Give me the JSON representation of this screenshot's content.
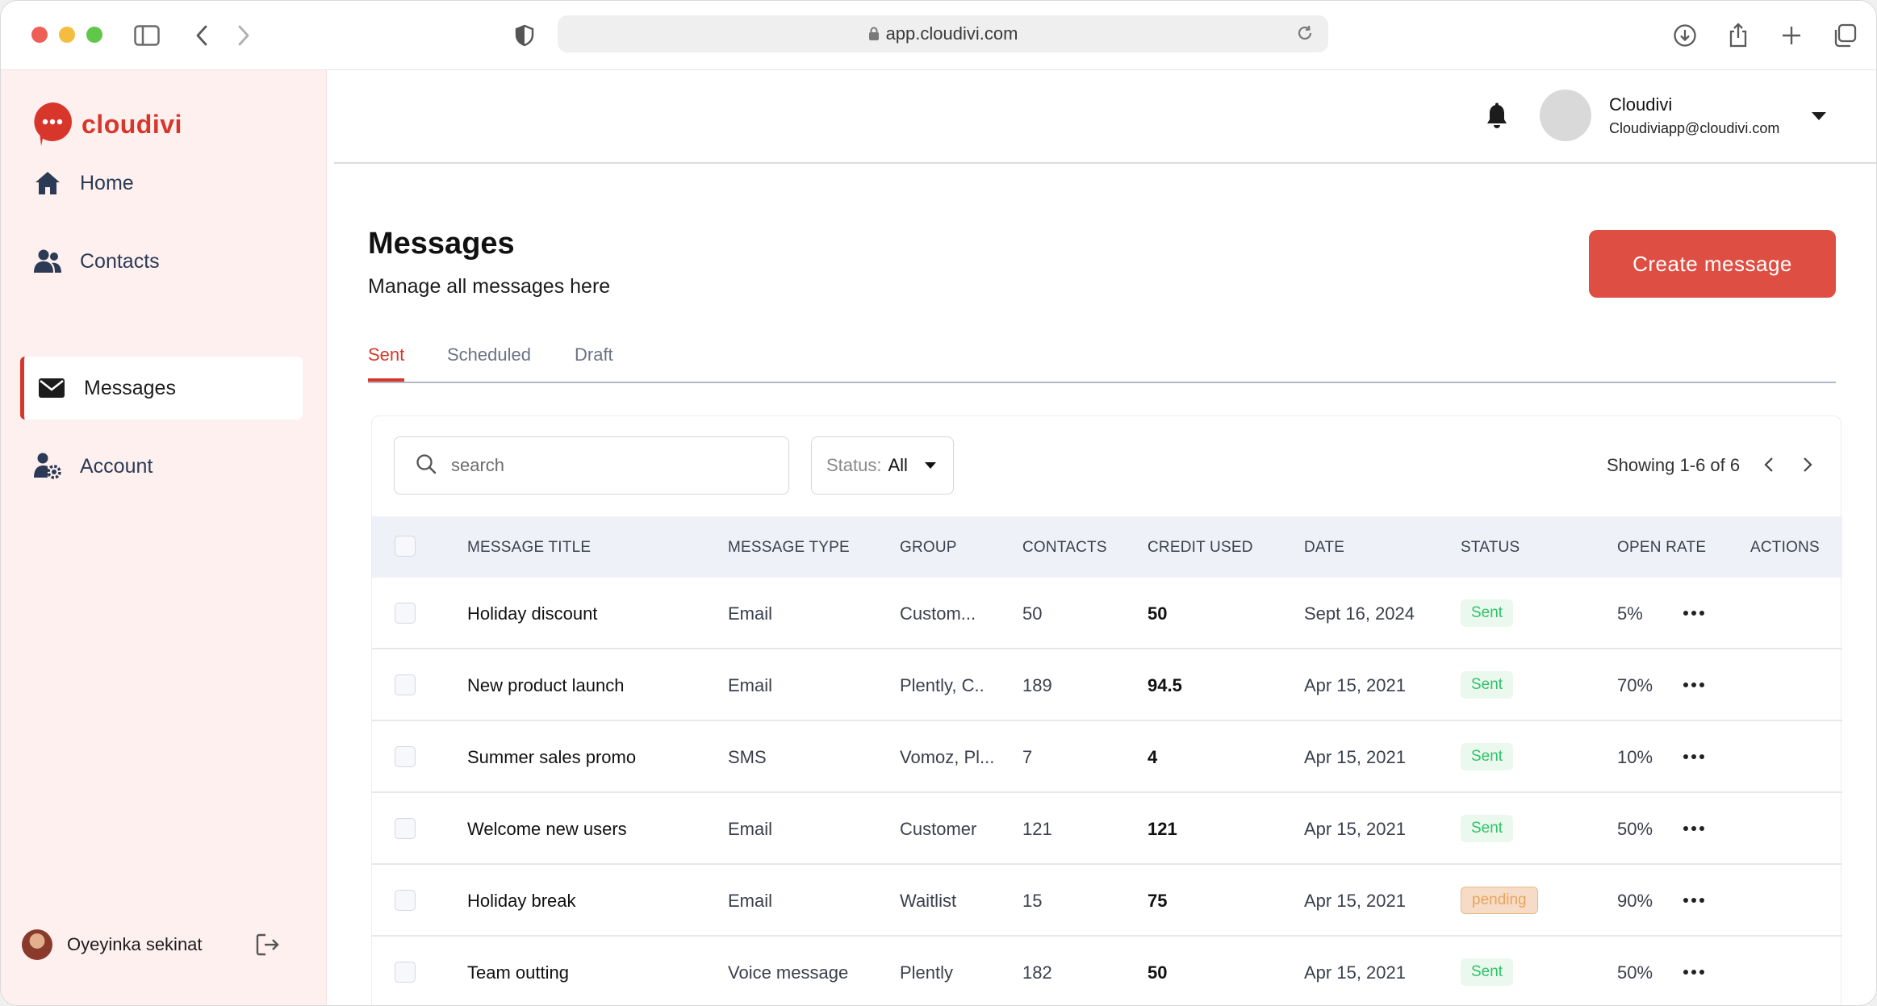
{
  "browser": {
    "url": "app.cloudivi.com"
  },
  "brand": {
    "name": "cloudivi",
    "accent": "#d8362b"
  },
  "sidebar": {
    "items": [
      {
        "label": "Home",
        "icon": "home-icon"
      },
      {
        "label": "Contacts",
        "icon": "contacts-icon"
      },
      {
        "label": "Messages",
        "icon": "envelope-icon",
        "active": true
      },
      {
        "label": "Account",
        "icon": "account-settings-icon"
      }
    ],
    "user": {
      "name": "Oyeyinka sekinat"
    }
  },
  "header": {
    "profile_name": "Cloudivi",
    "profile_email": "Cloudiviapp@cloudivi.com"
  },
  "page": {
    "title": "Messages",
    "subtitle": "Manage all messages here",
    "create_label": "Create  message"
  },
  "tabs": [
    {
      "label": "Sent",
      "active": true
    },
    {
      "label": "Scheduled"
    },
    {
      "label": "Draft"
    }
  ],
  "filters": {
    "search_placeholder": "search",
    "status_label": "Status:",
    "status_value": "All",
    "showing": "Showing 1-6 of 6"
  },
  "table": {
    "columns": [
      "MESSAGE TITLE",
      "MESSAGE TYPE",
      "GROUP",
      "CONTACTS",
      "CREDIT USED",
      "DATE",
      "STATUS",
      "OPEN RATE",
      "ACTIONS"
    ],
    "rows": [
      {
        "title": "Holiday discount",
        "type": "Email",
        "group": "Custom...",
        "contacts": "50",
        "credit": "50",
        "date": "Sept 16, 2024",
        "status": "Sent",
        "open_rate": "5%"
      },
      {
        "title": "New product launch",
        "type": "Email",
        "group": "Plently, C..",
        "contacts": "189",
        "credit": "94.5",
        "date": "Apr 15, 2021",
        "status": "Sent",
        "open_rate": "70%"
      },
      {
        "title": "Summer sales promo",
        "type": "SMS",
        "group": "Vomoz, Pl...",
        "contacts": "7",
        "credit": "4",
        "date": "Apr 15, 2021",
        "status": "Sent",
        "open_rate": "10%"
      },
      {
        "title": "Welcome new users",
        "type": "Email",
        "group": "Customer",
        "contacts": "121",
        "credit": "121",
        "date": "Apr 15, 2021",
        "status": "Sent",
        "open_rate": "50%"
      },
      {
        "title": "Holiday break",
        "type": "Email",
        "group": "Waitlist",
        "contacts": "15",
        "credit": "75",
        "date": "Apr 15, 2021",
        "status": "pending",
        "open_rate": "90%"
      },
      {
        "title": "Team outting",
        "type": "Voice message",
        "group": "Plently",
        "contacts": "182",
        "credit": "50",
        "date": "Apr 15, 2021",
        "status": "Sent",
        "open_rate": "50%"
      }
    ]
  },
  "colors": {
    "sent_badge": "#31c26a",
    "pending_badge": "#e8a45d",
    "create_button": "#de4e43",
    "sidebar_bg": "#fdf0ef"
  }
}
